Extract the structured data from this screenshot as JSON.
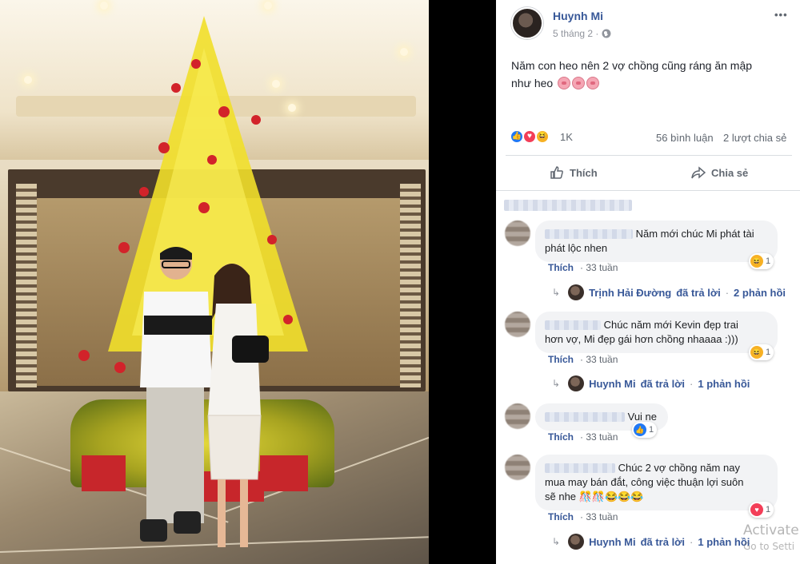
{
  "post": {
    "author": "Huynh Mi",
    "time": "5 tháng 2 ·",
    "text_line1": "Năm con heo nên 2 vợ chồng cũng ráng ăn mập",
    "text_line2": "như heo",
    "reaction_count": "1K",
    "comments_count": "56 bình luận",
    "shares_count": "2 lượt chia sẻ",
    "like_label": "Thích",
    "share_label": "Chia sẻ",
    "more_label": "•••"
  },
  "comments": [
    {
      "text_line1": "Năm mới chúc Mi phát tài",
      "text_line2": "phát lộc nhen",
      "like_label": "Thích",
      "dot": "·",
      "time": "33 tuần",
      "reaction_count": "1",
      "reply": {
        "author": "Trịnh Hải Đường",
        "verb": "đã trả lời",
        "dot": "·",
        "count": "2 phản hồi"
      }
    },
    {
      "text_line1": "Chúc năm mới Kevin đẹp trai",
      "text_line2": "hơn vợ, Mi đẹp gái hơn chồng nhaaaa :)))",
      "like_label": "Thích",
      "dot": "·",
      "time": "33 tuần",
      "reaction_count": "1",
      "reply": {
        "author": "Huynh Mi",
        "verb": "đã trả lời",
        "dot": "·",
        "count": "1 phản hồi"
      }
    },
    {
      "text_line1": "Vui ne",
      "like_label": "Thích",
      "dot": "·",
      "time": "33 tuần",
      "reaction_count": "1"
    },
    {
      "name_visible": "Thanh",
      "text_line1": "Chúc 2 vợ chồng năm nay",
      "text_line2": "mua may bán đắt, công việc thuận lợi suôn",
      "text_line3": "sẽ nhe",
      "like_label": "Thích",
      "dot": "·",
      "time": "33 tuần",
      "reaction_count": "1",
      "reply": {
        "author": "Huynh Mi",
        "verb": "đã trả lời",
        "dot": "·",
        "count": "1 phản hồi"
      }
    }
  ],
  "watermark": {
    "line1": "Activate",
    "line2": "Go to Setti"
  },
  "icons": {
    "globe": "globe-icon",
    "like": "like-icon",
    "share": "share-icon",
    "love": "love-reaction-icon",
    "haha": "haha-reaction-icon",
    "pig": "pig-emoji-icon"
  },
  "colors": {
    "link": "#385898",
    "like_blue": "#2078f4",
    "love_red": "#f33e58",
    "haha_yellow": "#f7b125"
  }
}
